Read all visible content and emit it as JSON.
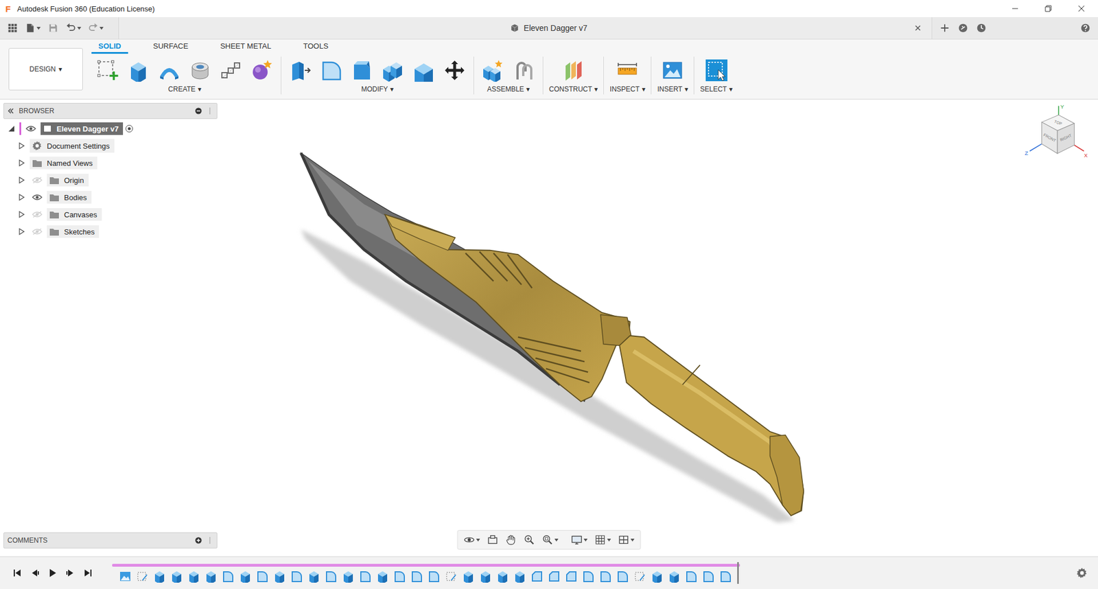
{
  "window": {
    "logo": "F",
    "title": "Autodesk Fusion 360 (Education License)"
  },
  "document_tab": {
    "title": "Eleven Dagger v7"
  },
  "workspace": {
    "label": "DESIGN",
    "caret": "▾"
  },
  "toolbar_tabs": [
    {
      "label": "SOLID",
      "selected": true
    },
    {
      "label": "SURFACE",
      "selected": false
    },
    {
      "label": "SHEET METAL",
      "selected": false
    },
    {
      "label": "TOOLS",
      "selected": false
    }
  ],
  "tool_groups": [
    {
      "label": "CREATE",
      "caret": "▾",
      "tools": [
        {
          "kind": "sketch"
        },
        {
          "kind": "extrude"
        },
        {
          "kind": "revolve"
        },
        {
          "kind": "hole"
        },
        {
          "kind": "pattern"
        },
        {
          "kind": "form"
        }
      ]
    },
    {
      "label": "MODIFY",
      "caret": "▾",
      "tools": [
        {
          "kind": "press-pull"
        },
        {
          "kind": "fillet"
        },
        {
          "kind": "chamfer"
        },
        {
          "kind": "combine"
        },
        {
          "kind": "offset-face"
        },
        {
          "kind": "move"
        }
      ]
    },
    {
      "label": "ASSEMBLE",
      "caret": "▾",
      "tools": [
        {
          "kind": "new-component"
        },
        {
          "kind": "joint"
        }
      ]
    },
    {
      "label": "CONSTRUCT",
      "caret": "▾",
      "tools": [
        {
          "kind": "plane"
        }
      ]
    },
    {
      "label": "INSPECT",
      "caret": "▾",
      "tools": [
        {
          "kind": "measure"
        }
      ]
    },
    {
      "label": "INSERT",
      "caret": "▾",
      "tools": [
        {
          "kind": "image"
        }
      ]
    },
    {
      "label": "SELECT",
      "caret": "▾",
      "tools": [
        {
          "kind": "select"
        }
      ]
    }
  ],
  "browser": {
    "title": "BROWSER",
    "root": {
      "label": "Eleven Dagger v7",
      "expanded": true,
      "visible": true,
      "active": true
    },
    "items": [
      {
        "label": "Document Settings",
        "kind": "settings",
        "expanded": false
      },
      {
        "label": "Named Views",
        "kind": "folder",
        "expanded": false
      },
      {
        "label": "Origin",
        "kind": "layer",
        "expanded": false,
        "visible": false
      },
      {
        "label": "Bodies",
        "kind": "layer",
        "expanded": false,
        "visible": true
      },
      {
        "label": "Canvases",
        "kind": "layer",
        "expanded": false,
        "visible": false
      },
      {
        "label": "Sketches",
        "kind": "layer",
        "expanded": false,
        "visible": false
      }
    ]
  },
  "comments": {
    "title": "COMMENTS"
  },
  "viewcube": {
    "top": "TOP",
    "front": "FRONT",
    "right": "RIGHT",
    "axis_x": "X",
    "axis_y": "Y",
    "axis_z": "Z"
  },
  "nav_tools": [
    {
      "kind": "orbit",
      "dropdown": true
    },
    {
      "kind": "look-at",
      "dropdown": false
    },
    {
      "kind": "pan",
      "dropdown": false
    },
    {
      "kind": "zoom",
      "dropdown": false
    },
    {
      "kind": "fit",
      "dropdown": true
    },
    {
      "kind": "display",
      "dropdown": true
    },
    {
      "kind": "grid",
      "dropdown": true
    },
    {
      "kind": "viewports",
      "dropdown": true
    }
  ],
  "timeline": {
    "features": [
      {
        "kind": "canvas"
      },
      {
        "kind": "sketch"
      },
      {
        "kind": "extrude"
      },
      {
        "kind": "extrude"
      },
      {
        "kind": "extrude"
      },
      {
        "kind": "extrude"
      },
      {
        "kind": "fillet"
      },
      {
        "kind": "extrude"
      },
      {
        "kind": "fillet"
      },
      {
        "kind": "extrude"
      },
      {
        "kind": "fillet"
      },
      {
        "kind": "extrude"
      },
      {
        "kind": "fillet"
      },
      {
        "kind": "extrude"
      },
      {
        "kind": "fillet"
      },
      {
        "kind": "extrude"
      },
      {
        "kind": "fillet"
      },
      {
        "kind": "fillet"
      },
      {
        "kind": "fillet"
      },
      {
        "kind": "sketch"
      },
      {
        "kind": "extrude"
      },
      {
        "kind": "extrude"
      },
      {
        "kind": "extrude"
      },
      {
        "kind": "extrude"
      },
      {
        "kind": "chamfer"
      },
      {
        "kind": "chamfer"
      },
      {
        "kind": "chamfer"
      },
      {
        "kind": "fillet"
      },
      {
        "kind": "fillet"
      },
      {
        "kind": "fillet"
      },
      {
        "kind": "sketch"
      },
      {
        "kind": "extrude"
      },
      {
        "kind": "extrude"
      },
      {
        "kind": "fillet"
      },
      {
        "kind": "fillet"
      },
      {
        "kind": "fillet"
      }
    ]
  }
}
